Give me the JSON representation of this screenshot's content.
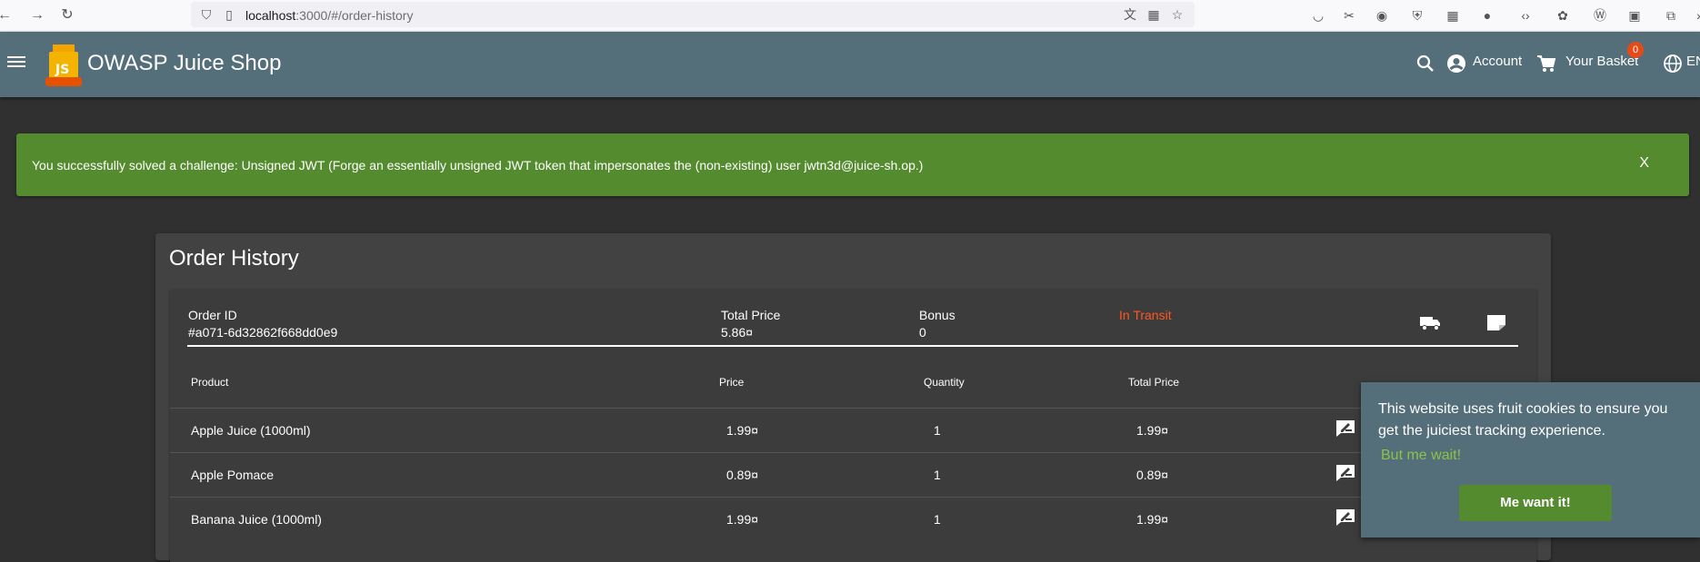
{
  "browser": {
    "url_host": "localhost",
    "url_path": ":3000/#/order-history"
  },
  "toolbar": {
    "title": "OWASP Juice Shop",
    "account_label": "Account",
    "basket_label": "Your Basket",
    "basket_count": "0",
    "language_label": "EN"
  },
  "notification": {
    "message": "You successfully solved a challenge: Unsigned JWT (Forge an essentially unsigned JWT token that impersonates the (non-existing) user jwtn3d@juice-sh.op.)",
    "close_label": "X"
  },
  "order_history": {
    "title": "Order History",
    "order": {
      "id_label": "Order ID",
      "id_value": "#a071-6d32862f668dd0e9",
      "total_label": "Total Price",
      "total_value": "5.86¤",
      "bonus_label": "Bonus",
      "bonus_value": "0",
      "status": "In Transit"
    },
    "columns": [
      "Product",
      "Price",
      "Quantity",
      "Total Price"
    ],
    "items": [
      {
        "product": "Apple Juice (1000ml)",
        "price": "1.99¤",
        "quantity": "1",
        "total": "1.99¤"
      },
      {
        "product": "Apple Pomace",
        "price": "0.89¤",
        "quantity": "1",
        "total": "0.89¤"
      },
      {
        "product": "Banana Juice (1000ml)",
        "price": "1.99¤",
        "quantity": "1",
        "total": "1.99¤"
      }
    ]
  },
  "cookie": {
    "message": "This website uses fruit cookies to ensure you get the juiciest tracking experience.",
    "link": "But me wait!",
    "button": "Me want it!"
  }
}
